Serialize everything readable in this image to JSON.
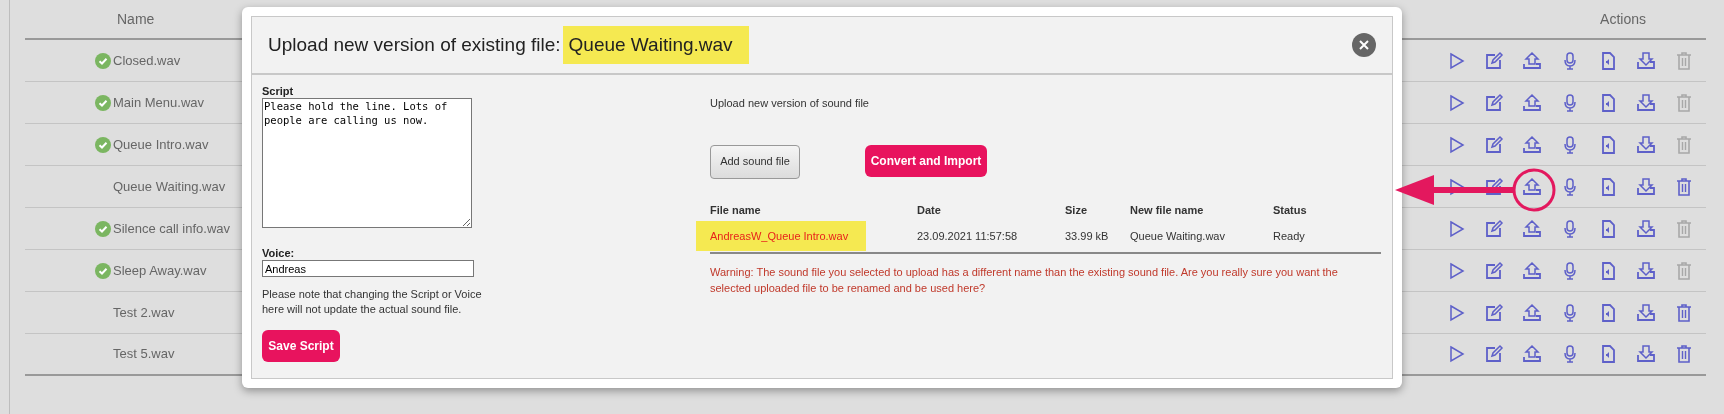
{
  "table": {
    "columns": [
      "Name",
      "Actions"
    ],
    "rows": [
      {
        "name": "Closed.wav",
        "ok": true,
        "delete_disabled": true
      },
      {
        "name": "Main Menu.wav",
        "ok": true,
        "delete_disabled": true
      },
      {
        "name": "Queue Intro.wav",
        "ok": true,
        "delete_disabled": true
      },
      {
        "name": "Queue Waiting.wav",
        "ok": false,
        "delete_disabled": false
      },
      {
        "name": "Silence call info.wav",
        "ok": true,
        "delete_disabled": true
      },
      {
        "name": "Sleep Away.wav",
        "ok": true,
        "delete_disabled": true
      },
      {
        "name": "Test 2.wav",
        "ok": false,
        "delete_disabled": false
      },
      {
        "name": "Test 5.wav",
        "ok": false,
        "delete_disabled": false
      }
    ]
  },
  "dialog": {
    "title": "Upload new version of existing file:",
    "title_file": "Queue Waiting.wav",
    "script_label": "Script",
    "script": "Please hold the line. Lots of people are calling us now.",
    "voice_label": "Voice:",
    "voice": "Andreas",
    "note": "Please note that changing the Script or Voice here will not update the actual sound file.",
    "save_button": "Save Script",
    "upload_label": "Upload new version of sound file",
    "add_button": "Add sound file",
    "convert_button": "Convert and Import",
    "files": {
      "columns": [
        "File name",
        "Date",
        "Size",
        "New file name",
        "Status"
      ],
      "rows": [
        {
          "cells": [
            "AndreasW_Queue Intro.wav",
            "23.09.2021 11:57:58",
            "33.99 kB",
            "Queue Waiting.wav",
            "Ready"
          ],
          "name_mismatch": true
        }
      ]
    },
    "warning": "Warning: The sound file you selected to upload has a different name than the existing sound file. Are you really sure you want the selected uploaded file to be renamed and be used here?"
  }
}
